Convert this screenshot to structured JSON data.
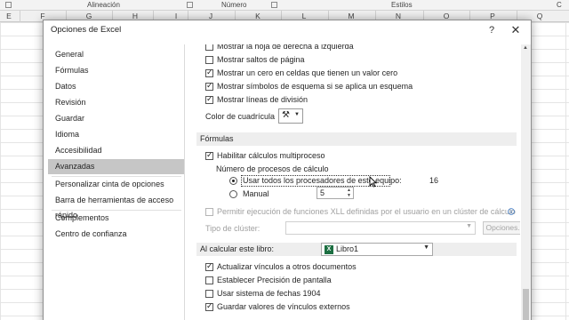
{
  "ribbon": {
    "groups": [
      "",
      "Alineación",
      "Número",
      "Estilos",
      "C"
    ]
  },
  "columns": [
    "E",
    "F",
    "G",
    "H",
    "I",
    "J",
    "K",
    "L",
    "M",
    "N",
    "O",
    "P",
    "Q"
  ],
  "dialog": {
    "title": "Opciones de Excel",
    "help": "?",
    "close": "✕"
  },
  "nav": {
    "items": [
      "General",
      "Fórmulas",
      "Datos",
      "Revisión",
      "Guardar",
      "Idioma",
      "Accesibilidad",
      "Avanzadas",
      "Personalizar cinta de opciones",
      "Barra de herramientas de acceso rápido",
      "Complementos",
      "Centro de confianza"
    ],
    "selected": "Avanzadas"
  },
  "options": {
    "right_to_left": "Mostrar la hoja de derecha a izquierda",
    "page_breaks": "Mostrar saltos de página",
    "show_zero": "Mostrar un cero en celdas que tienen un valor cero",
    "outline_symbols": "Mostrar símbolos de esquema si se aplica un esquema",
    "gridlines": "Mostrar líneas de división",
    "grid_color_label": "Color de cuadrícula",
    "formulas_section": "Fórmulas",
    "multithread": "Habilitar cálculos multiproceso",
    "num_threads_label": "Número de procesos de cálculo",
    "use_all_processors": "Usar todos los procesadores de este equipo:",
    "processor_count": "16",
    "manual_label": "Manual",
    "manual_value": "5",
    "xll_cluster": "Permitir ejecución de funciones XLL definidas por el usuario en un clúster de cálculo",
    "cluster_type_label": "Tipo de clúster:",
    "options_button": "Opciones...",
    "when_calculating_label": "Al calcular este libro:",
    "workbook_name": "Libro1",
    "update_links": "Actualizar vínculos a otros documentos",
    "set_precision": "Establecer Precisión de pantalla",
    "date_1904": "Usar sistema de fechas 1904",
    "save_external_values": "Guardar valores de vínculos externos"
  },
  "states": {
    "right_to_left": false,
    "page_breaks": false,
    "show_zero": true,
    "outline_symbols": true,
    "gridlines": true,
    "multithread": true,
    "use_all_processors": true,
    "xll_cluster": false,
    "update_links": true,
    "set_precision": false,
    "date_1904": false,
    "save_external_values": true
  },
  "colors": {
    "selected_nav": "#c6c6c6",
    "excel_green": "#1d6f42"
  }
}
